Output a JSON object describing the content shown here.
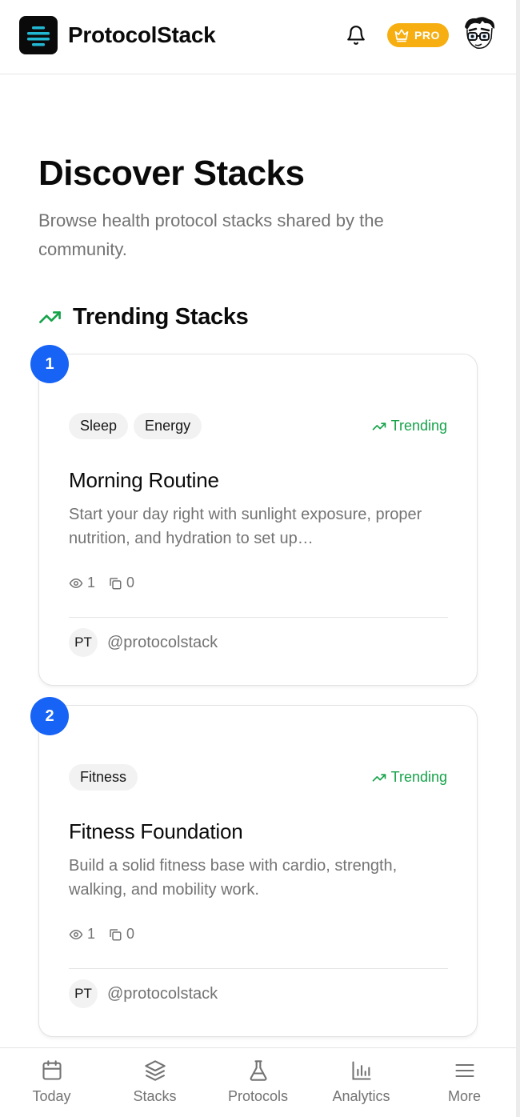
{
  "header": {
    "brand": "ProtocolStack",
    "pro_label": "PRO"
  },
  "main": {
    "title": "Discover Stacks",
    "subtitle": "Browse health protocol stacks shared by the community.",
    "section_title": "Trending Stacks"
  },
  "cards": [
    {
      "rank": "1",
      "tags": [
        "Sleep",
        "Energy"
      ],
      "trend_label": "Trending",
      "title": "Morning Routine",
      "description": "Start your day right with sunlight exposure, proper nutrition, and hydration to set up…",
      "views": "1",
      "copies": "0",
      "author_initials": "PT",
      "author_handle": "@protocolstack"
    },
    {
      "rank": "2",
      "tags": [
        "Fitness"
      ],
      "trend_label": "Trending",
      "title": "Fitness Foundation",
      "description": "Build a solid fitness base with cardio, strength, walking, and mobility work.",
      "views": "1",
      "copies": "0",
      "author_initials": "PT",
      "author_handle": "@protocolstack"
    }
  ],
  "nav": {
    "items": [
      {
        "label": "Today",
        "icon": "calendar-icon"
      },
      {
        "label": "Stacks",
        "icon": "layers-icon"
      },
      {
        "label": "Protocols",
        "icon": "flask-icon"
      },
      {
        "label": "Analytics",
        "icon": "bar-chart-icon"
      },
      {
        "label": "More",
        "icon": "menu-icon"
      }
    ]
  },
  "colors": {
    "accent": "#1763f5",
    "pro": "#f6ae10",
    "trending": "#16a34a",
    "logo_stripe": "#22b8d4"
  }
}
